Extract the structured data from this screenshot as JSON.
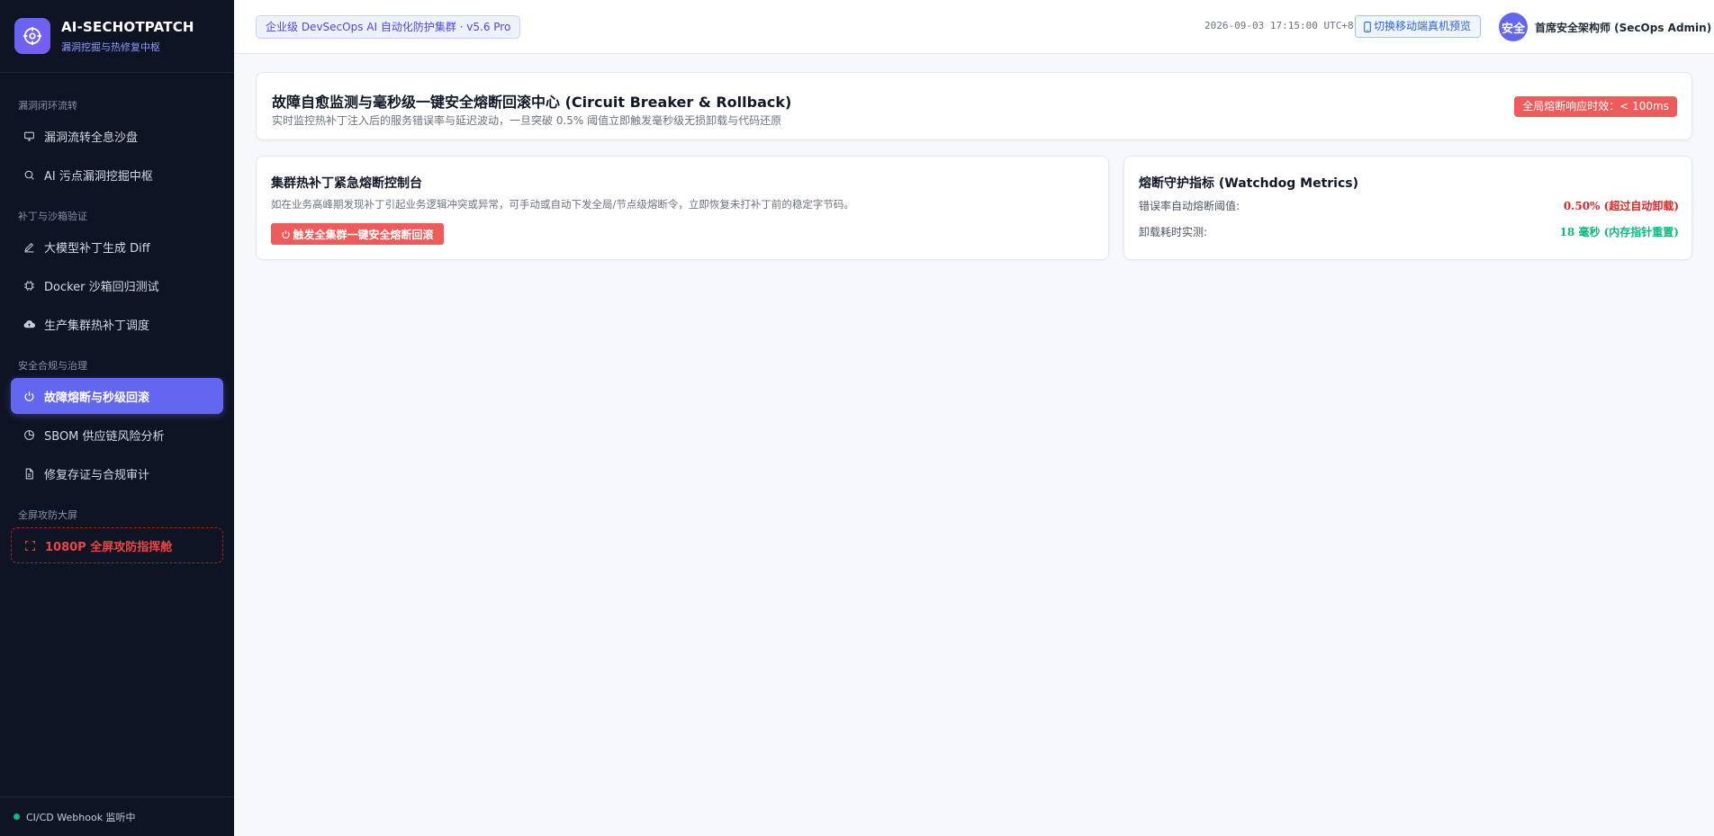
{
  "brand": {
    "title": "AI-SECHOTPATCH",
    "subtitle": "漏洞挖掘与热修复中枢",
    "logo_icon": "crosshair-icon"
  },
  "sidebar": {
    "groups": [
      {
        "title": "漏洞闭环流转",
        "items": [
          {
            "label": "漏洞流转全息沙盘",
            "icon": "monitor-icon"
          },
          {
            "label": "AI 污点漏洞挖掘中枢",
            "icon": "search-icon"
          }
        ]
      },
      {
        "title": "补丁与沙箱验证",
        "items": [
          {
            "label": "大模型补丁生成 Diff",
            "icon": "pen-icon"
          },
          {
            "label": "Docker 沙箱回归测试",
            "icon": "chip-icon"
          },
          {
            "label": "生产集群热补丁调度",
            "icon": "cloud-upload-icon"
          }
        ]
      },
      {
        "title": "安全合规与治理",
        "items": [
          {
            "label": "故障熔断与秒级回滚",
            "icon": "power-icon",
            "active": true
          },
          {
            "label": "SBOM 供应链风险分析",
            "icon": "pie-chart-icon"
          },
          {
            "label": "修复存证与合规审计",
            "icon": "document-icon"
          }
        ]
      },
      {
        "title": "全屏攻防大屏",
        "items": [
          {
            "label": "1080P 全屏攻防指挥舱",
            "icon": "fullscreen-icon"
          }
        ]
      }
    ],
    "footer": "CI/CD Webhook 监听中",
    "footer_status_color": "#10b981"
  },
  "header": {
    "version_badge": "企业级 DevSecOps AI 自动化防护集群 · v5.6 Pro",
    "clock": "2026-09-03 17:15:00 UTC+8",
    "mobile_button": "切换移动端真机预览",
    "avatar_text": "安全",
    "user_name": "首席安全架构师 (SecOps Admin)"
  },
  "hero": {
    "title": "故障自愈监测与毫秒级一键安全熔断回滚中心 (Circuit Breaker & Rollback)",
    "subtitle": "实时监控热补丁注入后的服务错误率与延迟波动，一旦突破 0.5% 阈值立即触发毫秒级无损卸载与代码还原",
    "badge": "全局熔断响应时效：< 100ms"
  },
  "console": {
    "title": "集群热补丁紧急熔断控制台",
    "description": "如在业务高峰期发现补丁引起业务逻辑冲突或异常，可手动或自动下发全局/节点级熔断令，立即恢复未打补丁前的稳定字节码。",
    "button": "触发全集群一键安全熔断回滚"
  },
  "metrics": {
    "title": "熔断守护指标 (Watchdog Metrics)",
    "rows": [
      {
        "label": "错误率自动熔断阈值:",
        "value": "0.50% (超过自动卸载)"
      },
      {
        "label": "卸载耗时实测:",
        "value": "18 毫秒 (内存指针重置)"
      }
    ]
  },
  "colors": {
    "accent": "#6366f1",
    "danger": "#ef5a5a",
    "success": "#10b981"
  }
}
